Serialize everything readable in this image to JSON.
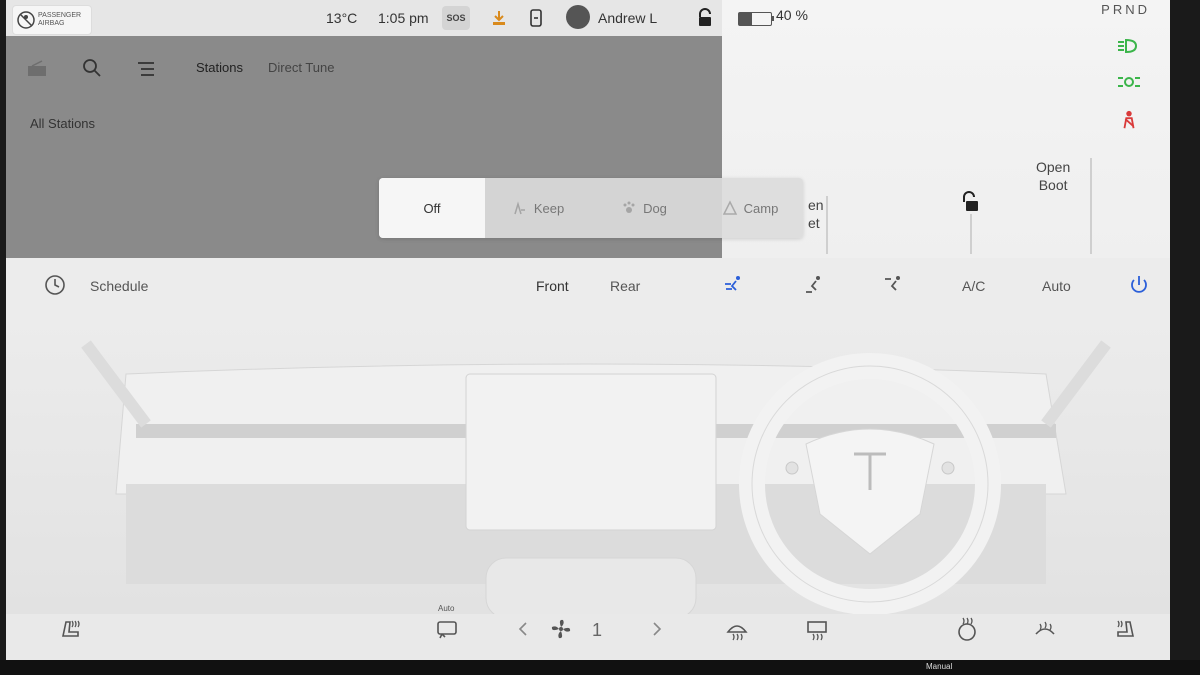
{
  "status": {
    "airbag_line1": "PASSENGER",
    "airbag_line2": "AIRBAG",
    "temperature": "13°C",
    "time": "1:05 pm",
    "sos": "SOS",
    "user": "Andrew L",
    "battery": "40 %",
    "battery_level": 0.4
  },
  "gear": "PRND",
  "media": {
    "tabs": [
      {
        "label": "Stations"
      },
      {
        "label": "Direct Tune"
      }
    ],
    "section_title": "All Stations"
  },
  "mode_popup": {
    "items": [
      {
        "label": "Off",
        "selected": true
      },
      {
        "label": "Keep",
        "selected": false
      },
      {
        "label": "Dog",
        "selected": false
      },
      {
        "label": "Camp",
        "selected": false
      }
    ]
  },
  "car": {
    "open_boot_line1": "Open",
    "open_boot_line2": "Boot",
    "bonnet_line1": "en",
    "bonnet_line2": "et"
  },
  "climate": {
    "schedule": "Schedule",
    "front": "Front",
    "rear": "Rear",
    "ac": "A/C",
    "auto": "Auto",
    "accent_color": "#2b5fd9"
  },
  "bottom": {
    "fan_speed": "1",
    "auto_label": "Auto",
    "manual_label": "Manual"
  }
}
